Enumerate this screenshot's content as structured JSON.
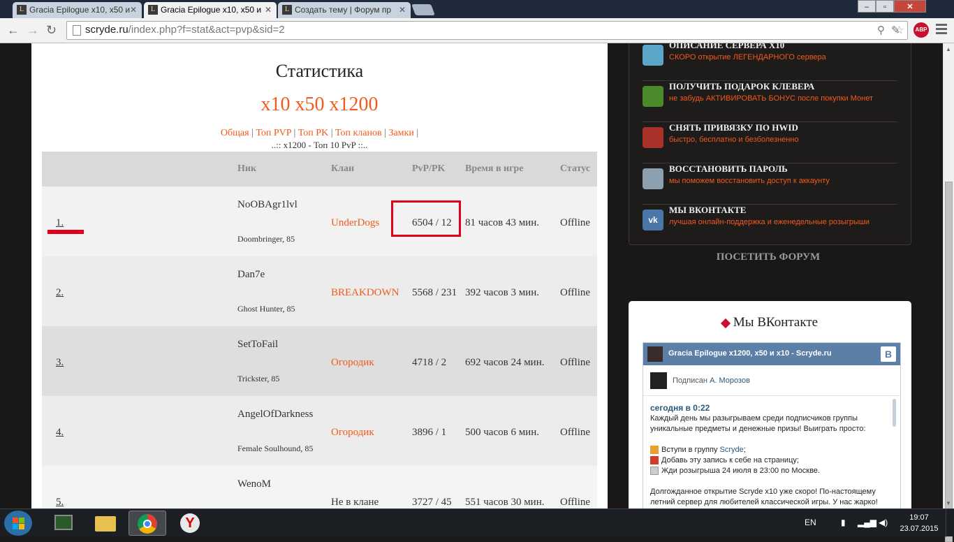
{
  "browser": {
    "tabs": [
      {
        "title": "Gracia Epilogue x10, x50 и"
      },
      {
        "title": "Gracia Epilogue x10, x50 и"
      },
      {
        "title": "Создать тему | Форум пр"
      }
    ],
    "url_host": "scryde.ru",
    "url_path": "/index.php?f=stat&act=pvp&sid=2",
    "abp_label": "ABP"
  },
  "stats": {
    "title": "Статистика",
    "rates": "x10 x50 x1200",
    "links": [
      "Общая",
      "Топ PVP",
      "Топ PK",
      "Топ кланов",
      "Замки"
    ],
    "subcaption": "..:: x1200 - Топ 10 PvP ::..",
    "headers": {
      "nick": "Ник",
      "clan": "Клан",
      "pvppk": "PvP/PK",
      "time": "Время в игре",
      "status": "Статус"
    },
    "rows": [
      {
        "rank": "1.",
        "nick": "NoOBAgr1lvl",
        "class": "Doombringer, 85",
        "clan": "UnderDogs",
        "pvp": "6504 / 12",
        "time": "81 часов 43 мин.",
        "status": "Offline"
      },
      {
        "rank": "2.",
        "nick": "Dan7e",
        "class": "Ghost Hunter, 85",
        "clan": "BREAKDOWN",
        "pvp": "5568 / 231",
        "time": "392 часов 3 мин.",
        "status": "Offline"
      },
      {
        "rank": "3.",
        "nick": "SetToFail",
        "class": "Trickster, 85",
        "clan": "Огородик",
        "pvp": "4718 / 2",
        "time": "692 часов 24 мин.",
        "status": "Offline"
      },
      {
        "rank": "4.",
        "nick": "AngelOfDarkness",
        "class": "Female Soulhound, 85",
        "clan": "Огородик",
        "pvp": "3896 / 1",
        "time": "500 часов 6 мин.",
        "status": "Offline"
      },
      {
        "rank": "5.",
        "nick": "WenoM",
        "class": "",
        "clan": "Не в клане",
        "pvp": "3727 / 45",
        "time": "551 часов 30 мин.",
        "status": "Offline"
      }
    ]
  },
  "sidebar": {
    "menu": [
      {
        "title": "ОПИСАНИЕ СЕРВЕРА Х10",
        "subtitle": "СКОРО открытие ЛЕГЕНДАРНОГО сервера",
        "icon": "server-description-icon",
        "color": "#5aa6c8"
      },
      {
        "title": "ПОЛУЧИТЬ ПОДАРОК КЛЕВЕРА",
        "subtitle": "не забудь АКТИВИРОВАТЬ БОНУС после покупки Монет",
        "icon": "clover-icon",
        "color": "#4a8a2a"
      },
      {
        "title": "СНЯТЬ ПРИВЯЗКУ ПО HWID",
        "subtitle": "быстро, бесплатно и безболезненно",
        "icon": "hwid-icon",
        "color": "#a8322a"
      },
      {
        "title": "ВОССТАНОВИТЬ ПАРОЛЬ",
        "subtitle": "мы поможем восстановить доступ к аккаунту",
        "icon": "password-icon",
        "color": "#8aa0b0"
      },
      {
        "title": "МЫ ВКОНТАКТЕ",
        "subtitle": "лучшая онлайн-поддержка и еженедельные розыгрыши",
        "icon": "vk-icon",
        "color": "#4a76a8"
      }
    ],
    "forum_link": "ПОСЕТИТЬ ФОРУМ",
    "vk": {
      "title": "Мы ВКонтакте",
      "group_name": "Gracia Epilogue x1200, x50 и x10 - Scryde.ru",
      "logo": "В",
      "subscribed_prefix": "Подписан",
      "subscriber": "А. Морозов",
      "post_time": "сегодня в 0:22",
      "post_lines": [
        "Каждый день мы разыгрываем среди подписчиков группы",
        "уникальные предметы и денежные призы! Выиграть просто:"
      ],
      "steps": [
        {
          "before": "Вступи в группу ",
          "link": "Scryde",
          "after": ";"
        },
        {
          "before": "Добавь эту запись к себе на страницу;",
          "link": "",
          "after": ""
        },
        {
          "before": "Жди розыгрыша 24 июля в 23:00 по Москве.",
          "link": "",
          "after": ""
        }
      ],
      "post_lines_2": [
        "Долгожданное открытие Scryde x10 уже скоро! По-настоящему",
        "летний сервер для любителей классической игры. У нас жарко!"
      ]
    }
  },
  "taskbar": {
    "lang": "EN",
    "time": "19:07",
    "date": "23.07.2015"
  }
}
